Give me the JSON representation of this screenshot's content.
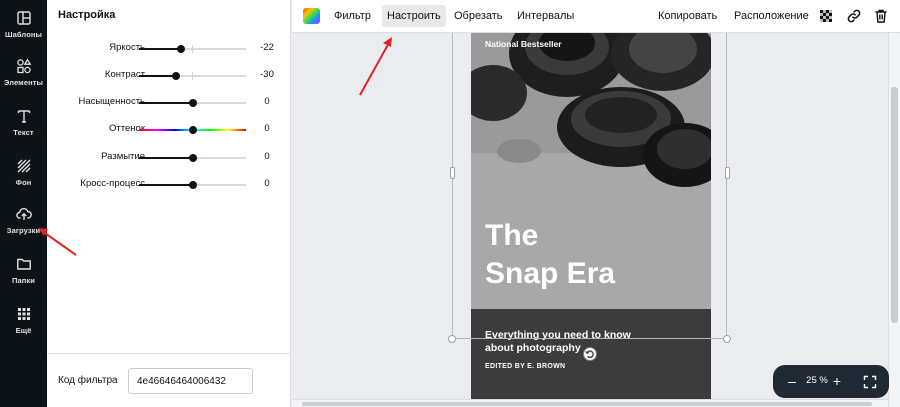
{
  "rail": {
    "items": [
      {
        "label": "Шаблоны",
        "icon": "templates-icon"
      },
      {
        "label": "Элементы",
        "icon": "elements-icon"
      },
      {
        "label": "Текст",
        "icon": "text-icon"
      },
      {
        "label": "Фон",
        "icon": "background-icon"
      },
      {
        "label": "Загрузки",
        "icon": "upload-cloud-icon"
      },
      {
        "label": "Папки",
        "icon": "folder-icon"
      },
      {
        "label": "Ещё",
        "icon": "more-grid-icon"
      }
    ]
  },
  "panel": {
    "title": "Настройка",
    "adjustments": [
      {
        "label": "Яркость",
        "value": "-22",
        "level": -22
      },
      {
        "label": "Контраст",
        "value": "-30",
        "level": -30
      },
      {
        "label": "Насыщенность",
        "value": "0",
        "level": 0
      },
      {
        "label": "Оттенок",
        "value": "0",
        "level": 0
      },
      {
        "label": "Размытие",
        "value": "0",
        "level": 0
      },
      {
        "label": "Кросс-процесс",
        "value": "0",
        "level": 0
      }
    ],
    "filter_code_label": "Код фильтра",
    "filter_code_value": "4e46646464006432"
  },
  "toolbar": {
    "filter": "Фильтр",
    "adjust": "Настроить",
    "crop": "Обрезать",
    "spacing": "Интервалы",
    "copy": "Копировать",
    "arrange": "Расположение"
  },
  "cover": {
    "badge": "National Bestseller",
    "title_line1": "The",
    "title_line2": "Snap Era",
    "subtitle_line1": "Everything you need to know",
    "subtitle_line2": "about photography",
    "edited_by": "EDITED BY E. BROWN"
  },
  "zoom": {
    "minus": "–",
    "value": "25 %",
    "plus": "+"
  },
  "colors": {
    "rail_bg": "#0e1318",
    "zoom_bg": "#1f2933",
    "annotation": "#e02424",
    "active_tab_bg": "#e6e8eb"
  }
}
